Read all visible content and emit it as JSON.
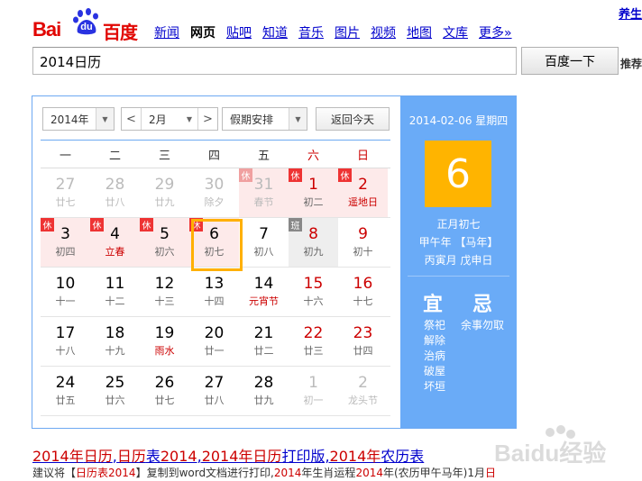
{
  "logo": {
    "part1": "Bai",
    "part2": "du",
    "part3": "百度"
  },
  "nav": [
    {
      "label": "新闻",
      "active": false
    },
    {
      "label": "网页",
      "active": true
    },
    {
      "label": "贴吧",
      "active": false
    },
    {
      "label": "知道",
      "active": false
    },
    {
      "label": "音乐",
      "active": false
    },
    {
      "label": "图片",
      "active": false
    },
    {
      "label": "视频",
      "active": false
    },
    {
      "label": "地图",
      "active": false
    },
    {
      "label": "文库",
      "active": false
    },
    {
      "label": "更多»",
      "active": false
    }
  ],
  "top_right_link": "养生",
  "side_right_label": "推荐",
  "search": {
    "value": "2014日历",
    "button": "百度一下"
  },
  "calendar": {
    "year_select": "2014年",
    "month_select": "2月",
    "prev": "<",
    "next": ">",
    "holiday_select": "假期安排",
    "today_button": "返回今天",
    "weekdays": [
      "一",
      "二",
      "三",
      "四",
      "五",
      "六",
      "日"
    ],
    "rows": [
      [
        {
          "d": "27",
          "l": "廿七",
          "dim": true
        },
        {
          "d": "28",
          "l": "廿八",
          "dim": true
        },
        {
          "d": "29",
          "l": "廿九",
          "dim": true
        },
        {
          "d": "30",
          "l": "除夕",
          "dim": true
        },
        {
          "d": "31",
          "l": "春节",
          "dim": true,
          "hol": true,
          "tag": "休"
        },
        {
          "d": "1",
          "l": "初二",
          "hol": true,
          "tag": "休",
          "wkend": true
        },
        {
          "d": "2",
          "l": "遥地日",
          "hol": true,
          "tag": "休",
          "wkend": true,
          "fest": true
        }
      ],
      [
        {
          "d": "3",
          "l": "初四",
          "hol": true,
          "tag": "休"
        },
        {
          "d": "4",
          "l": "立春",
          "hol": true,
          "tag": "休",
          "fest": true
        },
        {
          "d": "5",
          "l": "初六",
          "hol": true,
          "tag": "休"
        },
        {
          "d": "6",
          "l": "初七",
          "hol": true,
          "tag": "休",
          "sel": true
        },
        {
          "d": "7",
          "l": "初八"
        },
        {
          "d": "8",
          "l": "初九",
          "work": true,
          "tag": "班",
          "wkend": true
        },
        {
          "d": "9",
          "l": "初十",
          "wkend": true
        }
      ],
      [
        {
          "d": "10",
          "l": "十一"
        },
        {
          "d": "11",
          "l": "十二"
        },
        {
          "d": "12",
          "l": "十三"
        },
        {
          "d": "13",
          "l": "十四"
        },
        {
          "d": "14",
          "l": "元宵节",
          "fest": true
        },
        {
          "d": "15",
          "l": "十六",
          "wkend": true
        },
        {
          "d": "16",
          "l": "十七",
          "wkend": true
        }
      ],
      [
        {
          "d": "17",
          "l": "十八"
        },
        {
          "d": "18",
          "l": "十九"
        },
        {
          "d": "19",
          "l": "雨水",
          "fest": true
        },
        {
          "d": "20",
          "l": "廿一"
        },
        {
          "d": "21",
          "l": "廿二"
        },
        {
          "d": "22",
          "l": "廿三",
          "wkend": true
        },
        {
          "d": "23",
          "l": "廿四",
          "wkend": true
        }
      ],
      [
        {
          "d": "24",
          "l": "廿五"
        },
        {
          "d": "25",
          "l": "廿六"
        },
        {
          "d": "26",
          "l": "廿七"
        },
        {
          "d": "27",
          "l": "廿八"
        },
        {
          "d": "28",
          "l": "廿九"
        },
        {
          "d": "1",
          "l": "初一",
          "dim": true
        },
        {
          "d": "2",
          "l": "龙头节",
          "dim": true
        }
      ]
    ],
    "side": {
      "date": "2014-02-06 星期四",
      "day": "6",
      "lunar": "正月初七",
      "year_gz": "甲午年 【马年】",
      "month_day_gz": "丙寅月 戊申日",
      "yi_title": "宜",
      "ji_title": "忌",
      "yi": [
        "祭祀",
        "解除",
        "治病",
        "破屋",
        "坏垣"
      ],
      "ji": [
        "余事勿取"
      ]
    }
  },
  "result": {
    "title_parts": [
      {
        "t": "2014年",
        "em": true
      },
      {
        "t": "日历",
        "em": true
      },
      {
        "t": ",",
        "em": false
      },
      {
        "t": "日历",
        "em": true
      },
      {
        "t": "表",
        "em": false
      },
      {
        "t": "2014",
        "em": true
      },
      {
        "t": ",",
        "em": false
      },
      {
        "t": "2014年",
        "em": true
      },
      {
        "t": "日历",
        "em": true
      },
      {
        "t": "打印版,",
        "em": false
      },
      {
        "t": "2014年",
        "em": true
      },
      {
        "t": "农历表",
        "em": false
      }
    ],
    "desc_parts": [
      {
        "t": "建议将【",
        "em": false
      },
      {
        "t": "日历表2014",
        "em": true
      },
      {
        "t": "】复制到word文档进行打印,",
        "em": false
      },
      {
        "t": "2014",
        "em": true
      },
      {
        "t": "年生肖运程",
        "em": false
      },
      {
        "t": "2014",
        "em": true
      },
      {
        "t": "年(农历甲午马年)1月",
        "em": false
      },
      {
        "t": "日",
        "em": true
      }
    ]
  },
  "watermark": "Baidu经验",
  "colors": {
    "accent_blue": "#6aabf7",
    "holiday_bg": "#fdeaea",
    "selected": "#ffb000",
    "red": "#e10602",
    "link": "#0000cc"
  }
}
